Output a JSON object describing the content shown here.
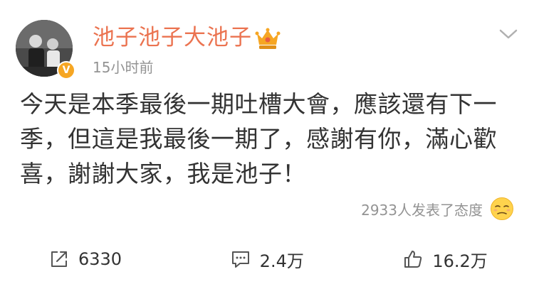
{
  "post": {
    "username": "池子池子大池子",
    "time": "15小时前",
    "text_lines": [
      "今天是本季最後一期吐槽大會，應該還有下一",
      "季，但這是我最後一期了，感謝有你，滿心歡",
      "喜，謝謝大家，我是池子！"
    ],
    "attitude_text": "2933人发表了态度",
    "avatar_badge": "V"
  },
  "actions": {
    "repost_count": "6330",
    "comment_count": "2.4万",
    "like_count": "16.2万"
  },
  "colors": {
    "username": "#eb7350",
    "meta_gray": "#939393",
    "text": "#333333",
    "badge": "#f6a623",
    "crown": "#f6a623"
  },
  "icons": {
    "menu": "chevron-down-icon",
    "vip": "crown-icon",
    "attitude": "sleepy-face-emoji-icon",
    "repost": "share-square-icon",
    "comment": "chat-bubble-icon",
    "like": "thumbs-up-icon"
  }
}
